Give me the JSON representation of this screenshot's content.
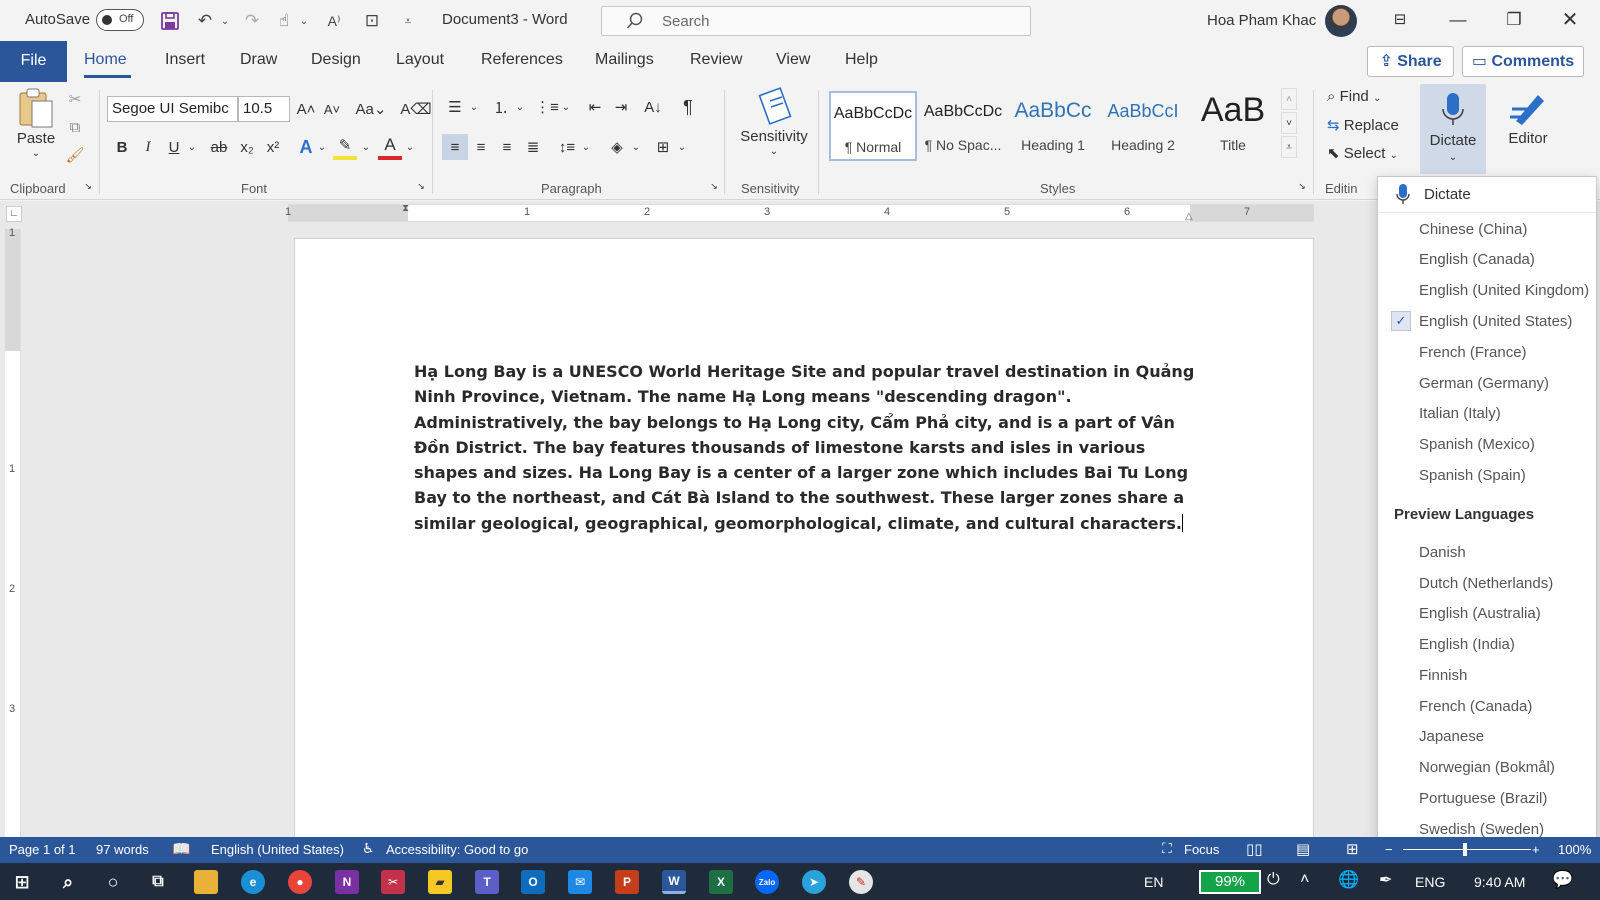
{
  "titlebar": {
    "autosave_label": "AutoSave",
    "autosave_state": "Off",
    "doc_title": "Document3  -  Word",
    "search_placeholder": "Search",
    "user_name": "Hoa Pham Khac"
  },
  "tabs": {
    "file": "File",
    "items": [
      "Home",
      "Insert",
      "Draw",
      "Design",
      "Layout",
      "References",
      "Mailings",
      "Review",
      "View",
      "Help"
    ],
    "active": "Home",
    "share": "Share",
    "comments": "Comments"
  },
  "ribbon": {
    "clipboard": {
      "label": "Clipboard",
      "paste": "Paste"
    },
    "font": {
      "label": "Font",
      "family": "Segoe UI Semibc",
      "size": "10.5",
      "case": "Aa"
    },
    "paragraph": {
      "label": "Paragraph"
    },
    "sensitivity": {
      "label": "Sensitivity",
      "button": "Sensitivity"
    },
    "styles": {
      "label": "Styles",
      "items": [
        {
          "sample": "AaBbCcDc",
          "name": "¶ Normal"
        },
        {
          "sample": "AaBbCcDc",
          "name": "¶ No Spac..."
        },
        {
          "sample": "AaBbCc",
          "name": "Heading 1"
        },
        {
          "sample": "AaBbCcI",
          "name": "Heading 2"
        },
        {
          "sample": "AaB",
          "name": "Title"
        }
      ]
    },
    "editing": {
      "label": "Editin",
      "find": "Find",
      "replace": "Replace",
      "select": "Select"
    },
    "dictate": "Dictate",
    "editor": "Editor"
  },
  "ruler": {
    "h_numbers": [
      "1",
      "1",
      "2",
      "3",
      "4",
      "5",
      "6",
      "7"
    ],
    "v_numbers": [
      "1",
      "1",
      "2",
      "3"
    ]
  },
  "document": {
    "body": "Hạ Long Bay is a UNESCO World Heritage Site and popular travel destination in Quảng Ninh Province, Vietnam. The name Hạ Long means \"descending dragon\". Administratively, the bay belongs to Hạ Long city, Cẩm Phả city, and is a part of Vân Đồn District. The bay features thousands of limestone karsts and isles in various shapes and sizes. Ha Long Bay is a center of a larger zone which includes Bai Tu Long Bay to the northeast, and Cát Bà Island to the southwest. These larger zones share a similar geological, geographical, geomorphological, climate, and cultural characters."
  },
  "dictate_menu": {
    "dictate": "Dictate",
    "languages": [
      "Chinese (China)",
      "English (Canada)",
      "English (United Kingdom)",
      "English (United States)",
      "French (France)",
      "German (Germany)",
      "Italian (Italy)",
      "Spanish (Mexico)",
      "Spanish (Spain)"
    ],
    "checked": "English (United States)",
    "preview_header": "Preview Languages",
    "preview": [
      "Danish",
      "Dutch (Netherlands)",
      "English (Australia)",
      "English (India)",
      "Finnish",
      "French (Canada)",
      "Japanese",
      "Norwegian (Bokmål)",
      "Portuguese (Brazil)",
      "Swedish (Sweden)"
    ]
  },
  "statusbar": {
    "page": "Page 1 of 1",
    "words": "97 words",
    "language": "English (United States)",
    "accessibility": "Accessibility: Good to go",
    "focus": "Focus",
    "zoom": "100%"
  },
  "taskbar": {
    "lang": "EN",
    "battery": "99%",
    "input": "ENG",
    "time": "9:40 AM"
  },
  "colors": {
    "accent": "#2b579a",
    "taskbar": "#1f2b3a",
    "battery": "#15a34a"
  }
}
